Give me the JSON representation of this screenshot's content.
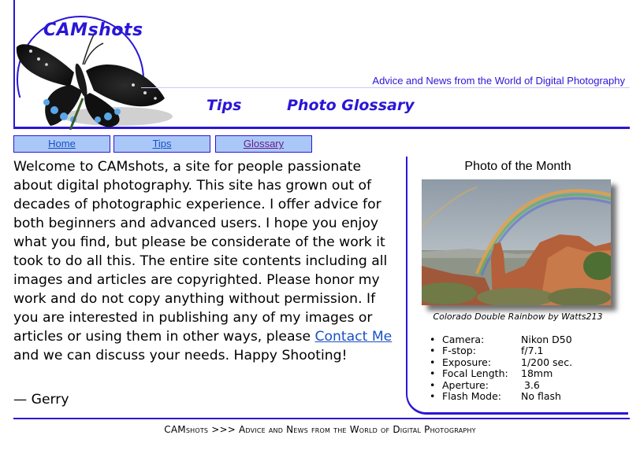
{
  "header": {
    "logo_text": "CAMshots",
    "tagline": "Advice and News from the World of Digital Photography",
    "nav": {
      "tips": "Tips",
      "glossary": "Photo Glossary"
    }
  },
  "tabs": [
    {
      "label": "Home"
    },
    {
      "label": "Tips"
    },
    {
      "label": "Glossary"
    }
  ],
  "main": {
    "intro_before_link": "Welcome to CAMshots, a site for people passionate about digital photography. This site has grown out of decades of photographic experience. I offer advice for both beginners and advanced users. I hope you enjoy what you find, but please be considerate of the work it took to do all this. The entire site contents including all images and articles are copyrighted. Please honor my work and do not copy anything without permission. If you are interested in publishing any of my images or articles or using them in other ways, please ",
    "contact_link": "Contact Me",
    "intro_after_link": " and we can discuss your needs. Happy Shooting!",
    "signature": "— Gerry"
  },
  "photo_of_month": {
    "title": "Photo of the Month",
    "caption": "Colorado Double Rainbow by Watts213",
    "specs": [
      {
        "label": "Camera:",
        "value": "Nikon D50"
      },
      {
        "label": "F-stop:",
        "value": "f/7.1"
      },
      {
        "label": "Exposure:",
        "value": "1/200 sec."
      },
      {
        "label": "Focal Length:",
        "value": "18mm"
      },
      {
        "label": "Aperture:",
        "value": " 3.6"
      },
      {
        "label": "Flash Mode:",
        "value": "No flash"
      }
    ]
  },
  "footer": {
    "text": "CAMshots >>> Advice and News from the World of Digital Photography"
  },
  "colors": {
    "accent": "#2a16d6",
    "tab_bg": "#aac8f7",
    "link": "#1a4fc7",
    "visited_link": "#6a1b8a"
  }
}
